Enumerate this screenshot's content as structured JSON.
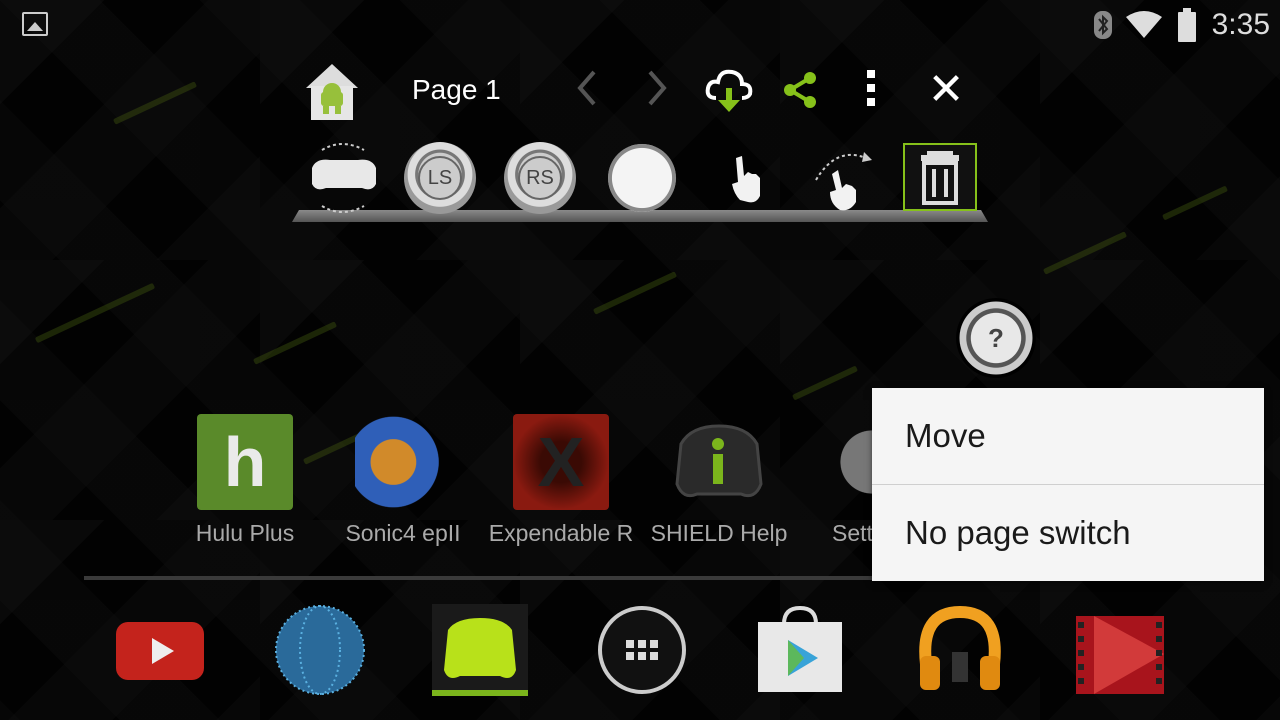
{
  "status_bar": {
    "time": "3:35",
    "icons": [
      "image-notification-icon",
      "bluetooth-icon",
      "wifi-icon",
      "battery-icon"
    ]
  },
  "toolbar": {
    "page_label": "Page 1",
    "icons": [
      "android-home-icon",
      "chevron-left-icon",
      "chevron-right-icon",
      "cloud-download-icon",
      "share-icon",
      "more-vert-icon",
      "close-icon"
    ]
  },
  "tools": [
    {
      "name": "gamepad-rotate-icon"
    },
    {
      "name": "left-stick",
      "label": "LS"
    },
    {
      "name": "right-stick",
      "label": "RS"
    },
    {
      "name": "button",
      "label": ""
    },
    {
      "name": "tap-gesture-icon"
    },
    {
      "name": "swipe-gesture-icon"
    },
    {
      "name": "trash-icon"
    }
  ],
  "help_button": {
    "label": "?"
  },
  "apps": [
    {
      "label": "Hulu Plus",
      "color": "#6aa630"
    },
    {
      "label": "Sonic4 epII",
      "color": "#2f5fb8"
    },
    {
      "label": "Expendable R",
      "color": "#8a1a10"
    },
    {
      "label": "SHIELD Help",
      "color": "#2a2a2a"
    },
    {
      "label": "Settings",
      "color": "#777777"
    }
  ],
  "dock": [
    "youtube-icon",
    "browser-globe-icon",
    "shield-hub-icon",
    "app-drawer-icon",
    "play-store-icon",
    "play-music-icon",
    "play-movies-icon"
  ],
  "menu": {
    "items": [
      "Move",
      "No page switch"
    ]
  },
  "colors": {
    "accent": "#86c11a"
  }
}
